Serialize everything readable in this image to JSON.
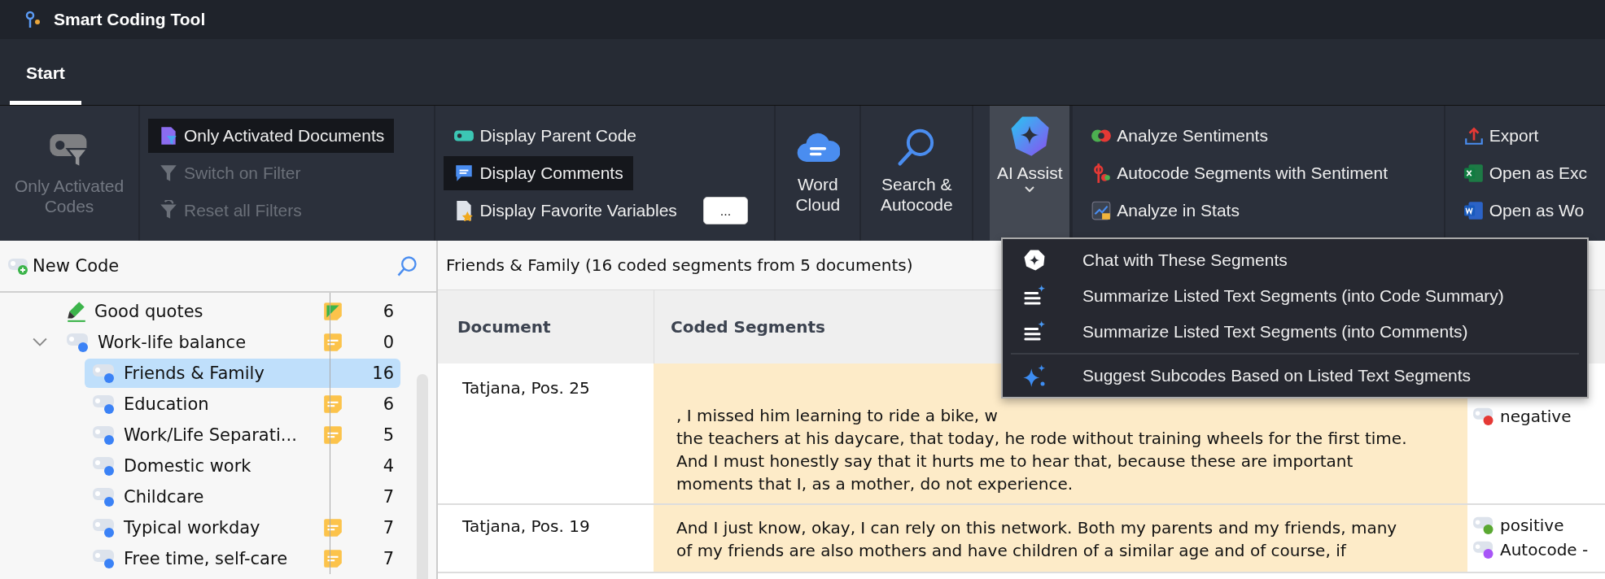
{
  "window": {
    "title": "Smart Coding Tool"
  },
  "tabs": [
    {
      "label": "Start",
      "selected": true
    }
  ],
  "ribbon": {
    "groups": [
      {
        "kind": "big",
        "items": [
          {
            "label": "Only Activated Codes",
            "selected": false,
            "disabled": true,
            "expanded": false
          }
        ]
      },
      {
        "kind": "column",
        "items": [
          {
            "label": "Only Activated Documents",
            "selected": true,
            "disabled": false
          },
          {
            "label": "Switch on Filter",
            "selected": false,
            "disabled": true
          },
          {
            "label": "Reset all Filters",
            "selected": false,
            "disabled": true
          }
        ]
      },
      {
        "kind": "column",
        "items": [
          {
            "label": "Display Parent Code",
            "selected": false,
            "disabled": false
          },
          {
            "label": "Display Comments",
            "selected": true,
            "disabled": false
          },
          {
            "label": "Display Favorite Variables",
            "selected": false,
            "disabled": false,
            "more": "..."
          }
        ]
      },
      {
        "kind": "big",
        "items": [
          {
            "label": "Word Cloud",
            "selected": false,
            "disabled": false,
            "expanded": false
          },
          {
            "label": "Search & Autocode",
            "selected": false,
            "disabled": false,
            "expanded": false
          },
          {
            "label": "AI Assist",
            "selected": true,
            "disabled": false,
            "expanded": true
          }
        ]
      },
      {
        "kind": "column",
        "items": [
          {
            "label": "Analyze Sentiments",
            "selected": false,
            "disabled": false
          },
          {
            "label": "Autocode Segments with Sentiment",
            "selected": false,
            "disabled": false
          },
          {
            "label": "Analyze in Stats",
            "selected": false,
            "disabled": false
          }
        ]
      },
      {
        "kind": "column",
        "items": [
          {
            "label": "Export",
            "selected": false,
            "disabled": false
          },
          {
            "label": "Open as Exc",
            "selected": false,
            "disabled": false
          },
          {
            "label": "Open as Wo",
            "selected": false,
            "disabled": false
          }
        ]
      }
    ]
  },
  "code_system": {
    "new_code": "New Code",
    "items": [
      {
        "label": "Good quotes",
        "kind": "highlighter",
        "memo": {
          "kind": "flag"
        },
        "count": "6",
        "selected": false
      },
      {
        "label": "Work-life balance",
        "kind": "code",
        "color": "#3b82f6",
        "memo": {
          "kind": "note"
        },
        "count": "0",
        "selected": false,
        "expanded": true,
        "children": [
          {
            "label": "Friends & Family",
            "kind": "code",
            "color": "#3b82f6",
            "count": "16",
            "selected": true
          },
          {
            "label": "Education",
            "kind": "code",
            "color": "#3b82f6",
            "memo": {
              "kind": "note"
            },
            "count": "6",
            "selected": false
          },
          {
            "label": "Work/Life Separati...",
            "kind": "code",
            "color": "#3b82f6",
            "memo": {
              "kind": "note"
            },
            "count": "5",
            "selected": false
          },
          {
            "label": "Domestic work",
            "kind": "code",
            "color": "#3b82f6",
            "count": "4",
            "selected": false
          },
          {
            "label": "Childcare",
            "kind": "code",
            "color": "#3b82f6",
            "count": "7",
            "selected": false
          },
          {
            "label": "Typical workday",
            "kind": "code",
            "color": "#3b82f6",
            "memo": {
              "kind": "note"
            },
            "count": "7",
            "selected": false
          },
          {
            "label": "Free time, self-care",
            "kind": "code",
            "color": "#3b82f6",
            "memo": {
              "kind": "note"
            },
            "count": "7",
            "selected": false
          }
        ]
      }
    ]
  },
  "segments": {
    "title": "Friends & Family (16 coded segments from 5 documents)",
    "columns": [
      "Document",
      "Coded Segments"
    ],
    "rows": [
      {
        "document": "Tatjana, Pos. 25",
        "lines": [
          ", I missed him learning to ride a bike, w",
          "the teachers at his daycare, that today, he rode without training wheels for the first time.",
          "And I must honestly say that it hurts me to hear that, because these are important",
          "moments that I, as a mother, do not experience."
        ],
        "codes": [
          {
            "label": "negative",
            "color": "#e53935"
          }
        ]
      },
      {
        "document": "Tatjana, Pos. 19",
        "lines": [
          "And I just know, okay, I can rely on this network. Both my parents and my friends, many",
          "of my friends are also mothers and have children of a similar age and of course, if"
        ],
        "codes": [
          {
            "label": "positive",
            "color": "#5aa832"
          },
          {
            "label": "Autocode -",
            "color": "#a855f7"
          }
        ]
      }
    ]
  },
  "ai_menu": {
    "items": [
      {
        "label": "Chat with These Segments",
        "kind": "chat"
      },
      {
        "label": "Summarize Listed Text Segments (into Code Summary)",
        "kind": "summarize"
      },
      {
        "label": "Summarize Listed Text Segments (into Comments)",
        "kind": "summarize"
      },
      {
        "kind": "separator"
      },
      {
        "label": "Suggest Subcodes Based on Listed Text Segments",
        "kind": "suggest"
      }
    ]
  }
}
